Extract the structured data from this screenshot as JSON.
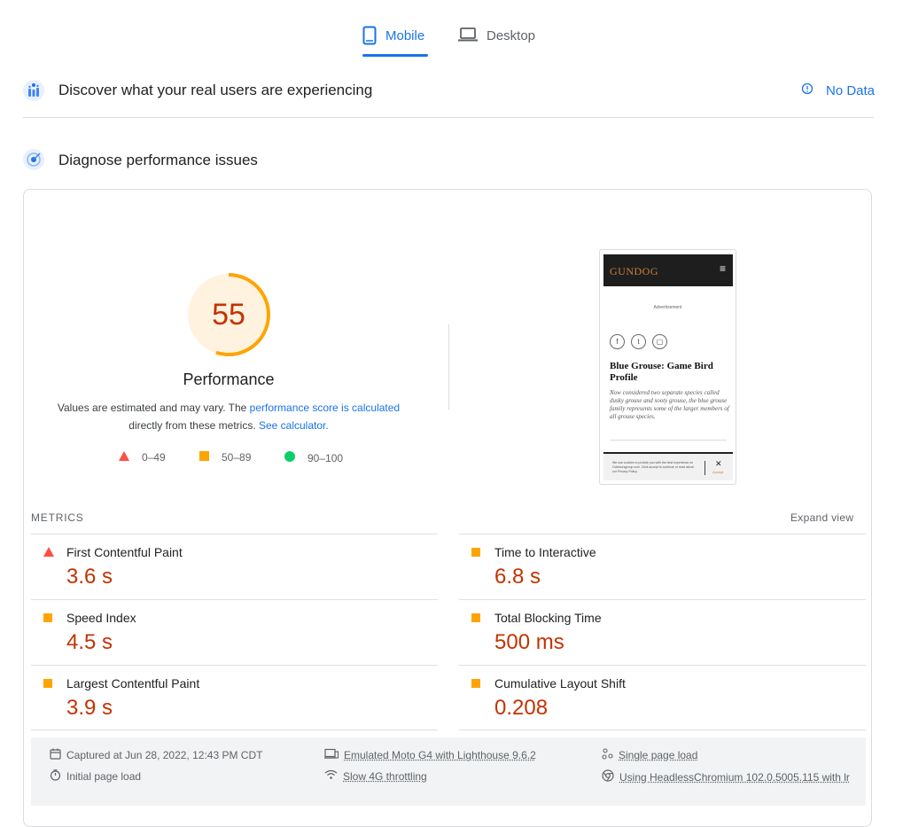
{
  "tabs": [
    {
      "label": "Mobile",
      "active": true
    },
    {
      "label": "Desktop",
      "active": false
    }
  ],
  "field_section": {
    "title": "Discover what your real users are experiencing",
    "status": "No Data"
  },
  "lab_section": {
    "title": "Diagnose performance issues"
  },
  "performance": {
    "score": 55,
    "title": "Performance",
    "desc_1": "Values are estimated and may vary. The ",
    "desc_link_1": "performance score is calculated",
    "desc_2": "directly from these metrics. ",
    "desc_link_2": "See calculator.",
    "legend": [
      {
        "range": "0–49",
        "shape": "triangle",
        "color": "#ff4e42"
      },
      {
        "range": "50–89",
        "shape": "square",
        "color": "#ffa400"
      },
      {
        "range": "90–100",
        "shape": "circle",
        "color": "#0cce6b"
      }
    ]
  },
  "screenshot": {
    "logo": "GUNDOG",
    "ad_label": "Advertisement",
    "article_title": "Blue Grouse: Game Bird Profile",
    "article_body": "Now considered two separate species called dusky grouse and sooty grouse, the blue grouse family represents some of the larger members of all grouse species.",
    "cookie_text": "We use cookies to provide you with the best experience on Outdoorsgroup.com. Click accept to continue or read about our Privacy Policy.",
    "accept": "Accept"
  },
  "metrics": {
    "header": "METRICS",
    "expand": "Expand view",
    "items": [
      {
        "name": "First Contentful Paint",
        "value": "3.6 s",
        "rating": "poor"
      },
      {
        "name": "Time to Interactive",
        "value": "6.8 s",
        "rating": "average"
      },
      {
        "name": "Speed Index",
        "value": "4.5 s",
        "rating": "average"
      },
      {
        "name": "Total Blocking Time",
        "value": "500 ms",
        "rating": "average"
      },
      {
        "name": "Largest Contentful Paint",
        "value": "3.9 s",
        "rating": "average"
      },
      {
        "name": "Cumulative Layout Shift",
        "value": "0.208",
        "rating": "average"
      }
    ]
  },
  "footer": {
    "captured": "Captured at Jun 28, 2022, 12:43 PM CDT",
    "device": "Emulated Moto G4 with Lighthouse 9.6.2",
    "load_type": "Single page load",
    "initial": "Initial page load",
    "throttling": "Slow 4G throttling",
    "browser": "Using HeadlessChromium 102.0.5005.115 with lr"
  },
  "colors": {
    "accent": "#1a73e8",
    "poor": "#ff4e42",
    "average": "#ffa400",
    "good": "#0cce6b",
    "score_text": "#c33300"
  }
}
